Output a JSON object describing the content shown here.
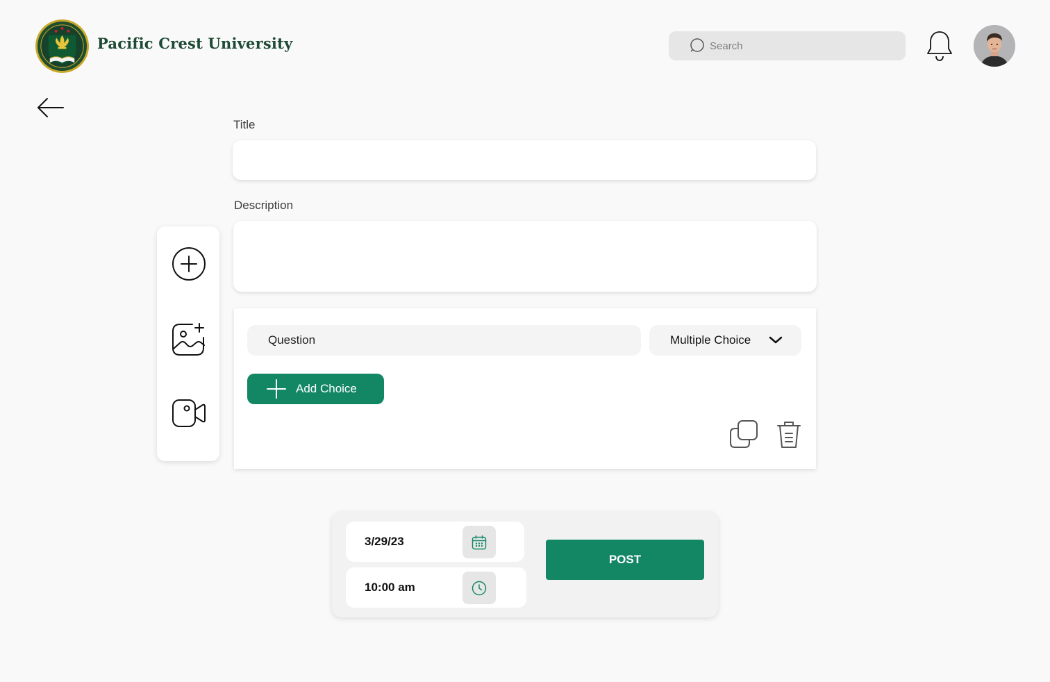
{
  "header": {
    "brand_name": "Pacific Crest University",
    "search_placeholder": "Search"
  },
  "form": {
    "title_label": "Title",
    "description_label": "Description"
  },
  "question": {
    "placeholder": "Question",
    "type_selected": "Multiple Choice",
    "add_choice_label": "Add Choice"
  },
  "schedule": {
    "date": "3/29/23",
    "time": "10:00 am",
    "post_label": "POST"
  },
  "colors": {
    "accent": "#138764",
    "brand": "#1e4a35"
  },
  "icons": {
    "back": "arrow-left-icon",
    "search": "search-icon",
    "notifications": "bell-icon",
    "add": "plus-circle-icon",
    "image": "add-image-icon",
    "video": "video-icon",
    "copy": "copy-icon",
    "delete": "trash-icon",
    "calendar": "calendar-icon",
    "clock": "clock-icon"
  }
}
